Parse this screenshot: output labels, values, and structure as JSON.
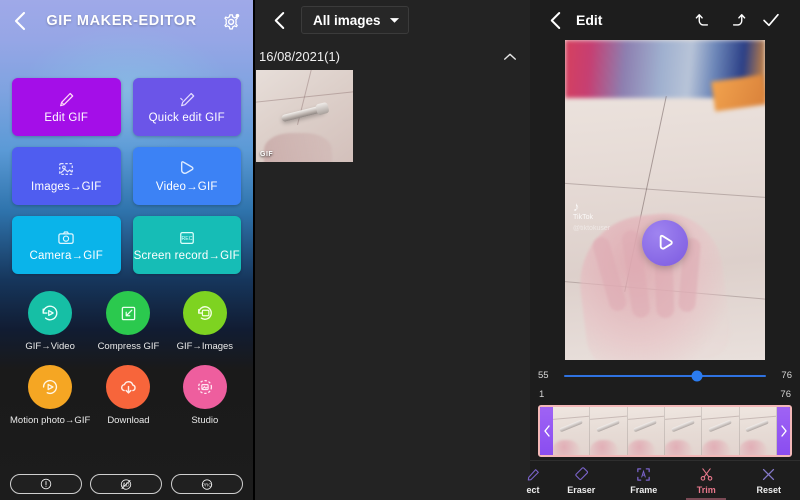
{
  "left_panel": {
    "back_icon": "chevron-left-icon",
    "title": "GIF MAKER-EDITOR",
    "settings_icon": "gear-icon",
    "big_cards": [
      {
        "label": "Edit GIF",
        "icon": "brush-icon",
        "color": "#a40ee8"
      },
      {
        "label": "Quick edit GIF",
        "icon": "brush-icon",
        "color": "#6b55e8"
      },
      {
        "label": "Images→GIF",
        "icon": "image-icon",
        "color": "#4f5df0"
      },
      {
        "label": "Video→GIF",
        "icon": "play-icon",
        "color": "#3c82f5"
      },
      {
        "label": "Camera→GIF",
        "icon": "camera-icon",
        "color": "#0ab4ea"
      },
      {
        "label": "Screen record→GIF",
        "icon": "rec-icon",
        "color": "#16bdb6"
      }
    ],
    "circle_items": [
      {
        "label": "GIF→Video",
        "icon": "rewind-play-icon",
        "color": "#16bfa5"
      },
      {
        "label": "Compress GIF",
        "icon": "compress-icon",
        "color": "#2bc94e"
      },
      {
        "label": "GIF→Images",
        "icon": "image-refresh-icon",
        "color": "#7ed321"
      },
      {
        "label": "Motion photo→GIF",
        "icon": "motion-play-icon",
        "color": "#f5a623"
      },
      {
        "label": "Download",
        "icon": "cloud-download-icon",
        "color": "#f7653b"
      },
      {
        "label": "Studio",
        "icon": "studio-icon",
        "color": "#ee5e9e"
      }
    ],
    "pills": [
      {
        "name": "info-pill",
        "icon": "exclamation-circle-icon"
      },
      {
        "name": "noads-pill",
        "icon": "no-ads-icon",
        "text": "AD"
      },
      {
        "name": "pro-pill",
        "icon": "pro-badge-icon",
        "text": "PRO"
      }
    ]
  },
  "middle_panel": {
    "back_icon": "chevron-left-icon",
    "filter_label": "All images",
    "filter_caret": "caret-down-icon",
    "date_group": "16/08/2021(1)",
    "collapse_icon": "chevron-up-icon",
    "thumbnail": {
      "badge": "GIF"
    }
  },
  "right_panel": {
    "back_icon": "chevron-left-icon",
    "title": "Edit",
    "undo_icon": "undo-icon",
    "redo_icon": "redo-icon",
    "confirm_icon": "check-icon",
    "preview": {
      "play_icon": "play-circle-icon",
      "watermark": "TikTok",
      "watermark_handle": "@tiktokuser"
    },
    "slider": {
      "start_value": "55",
      "end_value": "76",
      "knob_position_pct": 66
    },
    "range": {
      "min": "1",
      "max": "76"
    },
    "timeline": {
      "left_handle_icon": "chevron-left-icon",
      "right_handle_icon": "chevron-right-icon",
      "frame_count": 6
    },
    "toolbar": [
      {
        "label": "ect",
        "icon": "effect-icon",
        "active": false
      },
      {
        "label": "Eraser",
        "icon": "eraser-icon",
        "active": false
      },
      {
        "label": "Frame",
        "icon": "frame-icon",
        "active": false
      },
      {
        "label": "Trim",
        "icon": "scissors-icon",
        "active": true
      },
      {
        "label": "Reset",
        "icon": "close-x-icon",
        "active": false
      }
    ]
  },
  "colors": {
    "accent_purple": "#8a4df0",
    "accent_blue": "#2b7cf0",
    "active_tool": "#e8788c",
    "panel_bg": "#1d1d1d"
  }
}
